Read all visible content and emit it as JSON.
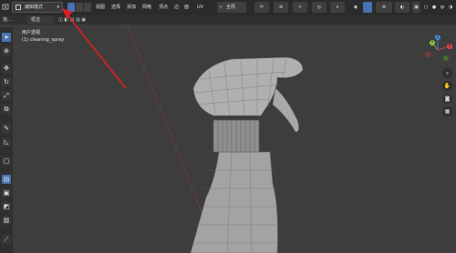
{
  "header": {
    "mode_label": "编辑模式",
    "menu": [
      "视图",
      "选择",
      "添加",
      "网格",
      "顶点",
      "边",
      "面",
      "UV"
    ],
    "transform_orientation": "全局"
  },
  "header2": {
    "items": [
      "拖...",
      "框选"
    ]
  },
  "viewport": {
    "view_name": "用户透视",
    "object_name": "(1) cleaning_spray"
  },
  "gizmo": {
    "x": "X",
    "y": "Y",
    "z": "Z"
  },
  "colors": {
    "annotation_arrow": "#e02020",
    "accent": "#4772b3"
  },
  "icons": [
    "cursor-icon",
    "move-icon",
    "rotate-icon",
    "scale-icon",
    "transform-icon",
    "annotate-icon",
    "measure-icon",
    "add-cube-icon",
    "extrude-icon",
    "inset-icon",
    "bevel-icon",
    "loop-cut-icon",
    "knife-icon"
  ]
}
